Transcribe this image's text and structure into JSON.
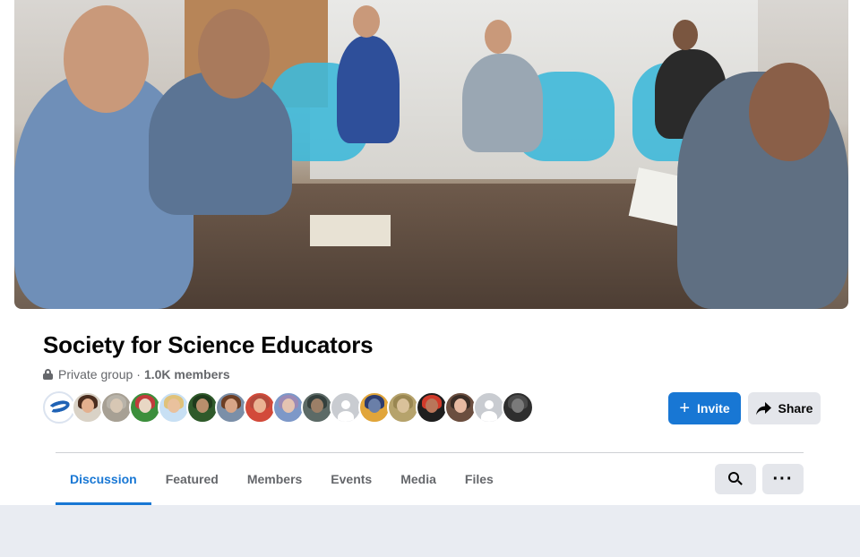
{
  "group": {
    "name": "Society for Science Educators",
    "privacy": "Private group",
    "separator": "·",
    "members": "1.0K members"
  },
  "cover": {
    "icon": "cover-photo"
  },
  "avatars": [
    {
      "kind": "logo"
    },
    {
      "kind": "photo",
      "skin": "#e3b08e",
      "hair": "#4a2d1e",
      "shirt": "#d9d2c6"
    },
    {
      "kind": "photo",
      "skin": "#d7c7b4",
      "hair": "#b8b3a9",
      "shirt": "#a7a094"
    },
    {
      "kind": "photo",
      "skin": "#e8d7c4",
      "hair": "#c23b3b",
      "shirt": "#3c8f3c"
    },
    {
      "kind": "photo",
      "skin": "#e9c19d",
      "hair": "#e0c27a",
      "shirt": "#c8e0f4"
    },
    {
      "kind": "photo",
      "skin": "#b88f6c",
      "hair": "#1f3b1c",
      "shirt": "#2f5a2a"
    },
    {
      "kind": "photo",
      "skin": "#d7a587",
      "hair": "#6d3e24",
      "shirt": "#7b8fa8"
    },
    {
      "kind": "photo",
      "skin": "#eab393",
      "hair": "#b44a3c",
      "shirt": "#d24a3a"
    },
    {
      "kind": "photo",
      "skin": "#e4c3b1",
      "hair": "#9c8ab5",
      "shirt": "#7d98c8"
    },
    {
      "kind": "photo",
      "skin": "#9b7f67",
      "hair": "#34403d",
      "shirt": "#5c6a66"
    },
    {
      "kind": "default"
    },
    {
      "kind": "photo",
      "skin": "#6a7fa8",
      "hair": "#2d3c6e",
      "shirt": "#e1a53a"
    },
    {
      "kind": "photo",
      "skin": "#d9c19a",
      "hair": "#9a8752",
      "shirt": "#b6a36c"
    },
    {
      "kind": "photo",
      "skin": "#b9765a",
      "hair": "#d13b2b",
      "shirt": "#1e1e1e"
    },
    {
      "kind": "photo",
      "skin": "#e6b9a1",
      "hair": "#3a2d26",
      "shirt": "#6b4e3f"
    },
    {
      "kind": "default"
    },
    {
      "kind": "photo",
      "skin": "#7a7a7a",
      "hair": "#4a4a4a",
      "shirt": "#2e2e2e"
    }
  ],
  "actions": {
    "invite_label": "Invite",
    "invite_icon": "plus-icon",
    "share_label": "Share",
    "share_icon": "share-arrow-icon"
  },
  "tabs": [
    {
      "label": "Discussion",
      "active": true
    },
    {
      "label": "Featured",
      "active": false
    },
    {
      "label": "Members",
      "active": false
    },
    {
      "label": "Events",
      "active": false
    },
    {
      "label": "Media",
      "active": false
    },
    {
      "label": "Files",
      "active": false
    }
  ],
  "toolbar": {
    "search_icon": "search-icon",
    "more_label": "···"
  },
  "colors": {
    "accent": "#1877d4",
    "secondary_button": "#e4e6eb",
    "muted_text": "#65676b",
    "feed_bg": "#e9ecf2"
  }
}
